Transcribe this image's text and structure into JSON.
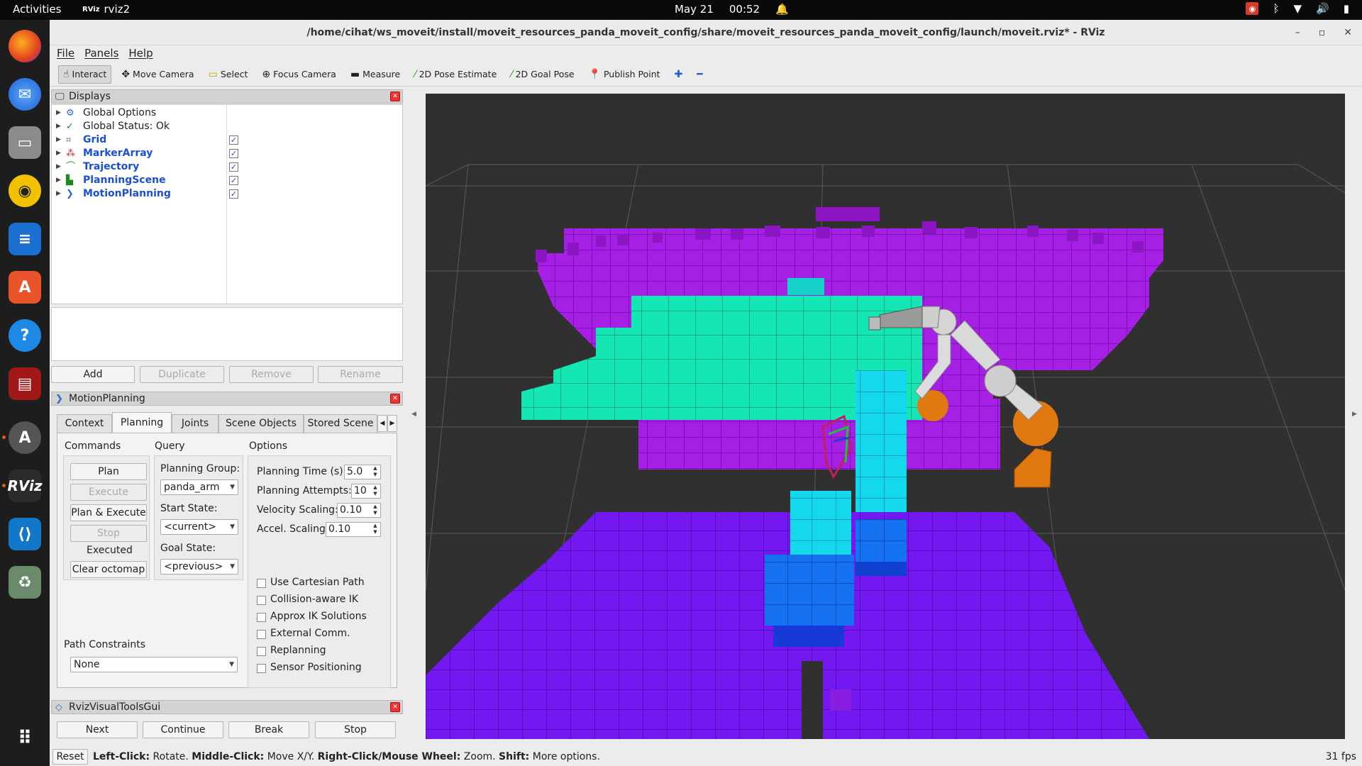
{
  "topbar": {
    "activities": "Activities",
    "app_icon": "RViz",
    "app_name": "rviz2",
    "date": "May 21",
    "time": "00:52"
  },
  "window": {
    "title": "/home/cihat/ws_moveit/install/moveit_resources_panda_moveit_config/share/moveit_resources_panda_moveit_config/launch/moveit.rviz* - RViz"
  },
  "menu": {
    "file": "File",
    "panels": "Panels",
    "help": "Help"
  },
  "toolbar": {
    "interact": "Interact",
    "move_camera": "Move Camera",
    "select": "Select",
    "focus_camera": "Focus Camera",
    "measure": "Measure",
    "pose_estimate": "2D Pose Estimate",
    "goal_pose": "2D Goal Pose",
    "publish_point": "Publish Point"
  },
  "displays": {
    "title": "Displays",
    "items": [
      {
        "label": "Global Options"
      },
      {
        "label": "Global Status: Ok"
      },
      {
        "label": "Grid"
      },
      {
        "label": "MarkerArray"
      },
      {
        "label": "Trajectory"
      },
      {
        "label": "PlanningScene"
      },
      {
        "label": "MotionPlanning"
      }
    ],
    "buttons": {
      "add": "Add",
      "duplicate": "Duplicate",
      "remove": "Remove",
      "rename": "Rename"
    }
  },
  "motion_planning": {
    "title": "MotionPlanning",
    "tabs": [
      "Context",
      "Planning",
      "Joints",
      "Scene Objects",
      "Stored Scene"
    ],
    "commands": {
      "title": "Commands",
      "plan": "Plan",
      "execute": "Execute",
      "plan_execute": "Plan & Execute",
      "stop": "Stop",
      "status": "Executed",
      "clear_octomap": "Clear octomap"
    },
    "query": {
      "title": "Query",
      "group_label": "Planning Group:",
      "group_value": "panda_arm",
      "start_label": "Start State:",
      "start_value": "<current>",
      "goal_label": "Goal State:",
      "goal_value": "<previous>"
    },
    "options": {
      "title": "Options",
      "planning_time_label": "Planning Time (s):",
      "planning_time": "5.0",
      "attempts_label": "Planning Attempts:",
      "attempts": "10",
      "velocity_label": "Velocity Scaling:",
      "velocity": "0.10",
      "accel_label": "Accel. Scaling:",
      "accel": "0.10",
      "checkboxes": [
        "Use Cartesian Path",
        "Collision-aware IK",
        "Approx IK Solutions",
        "External Comm.",
        "Replanning",
        "Sensor Positioning"
      ]
    },
    "path_constraints": {
      "label": "Path Constraints",
      "value": "None"
    }
  },
  "visual_tools": {
    "title": "RvizVisualToolsGui",
    "next": "Next",
    "continue": "Continue",
    "break": "Break",
    "stop": "Stop"
  },
  "statusbar": {
    "reset": "Reset",
    "left_click": "Left-Click:",
    "left_action": "Rotate.",
    "middle_click": "Middle-Click:",
    "middle_action": "Move X/Y.",
    "right_click": "Right-Click/Mouse Wheel:",
    "right_action": "Zoom.",
    "shift": "Shift:",
    "shift_action": "More options.",
    "fps": "31 fps"
  },
  "colors": {
    "octomap_magenta": "#a020e0",
    "octomap_violet": "#7010f0",
    "octomap_teal": "#10e0b0",
    "octomap_cyan": "#10d8e8",
    "octomap_blue": "#1060f0",
    "robot_orange": "#e07a10",
    "viewport_bg": "#303030"
  }
}
